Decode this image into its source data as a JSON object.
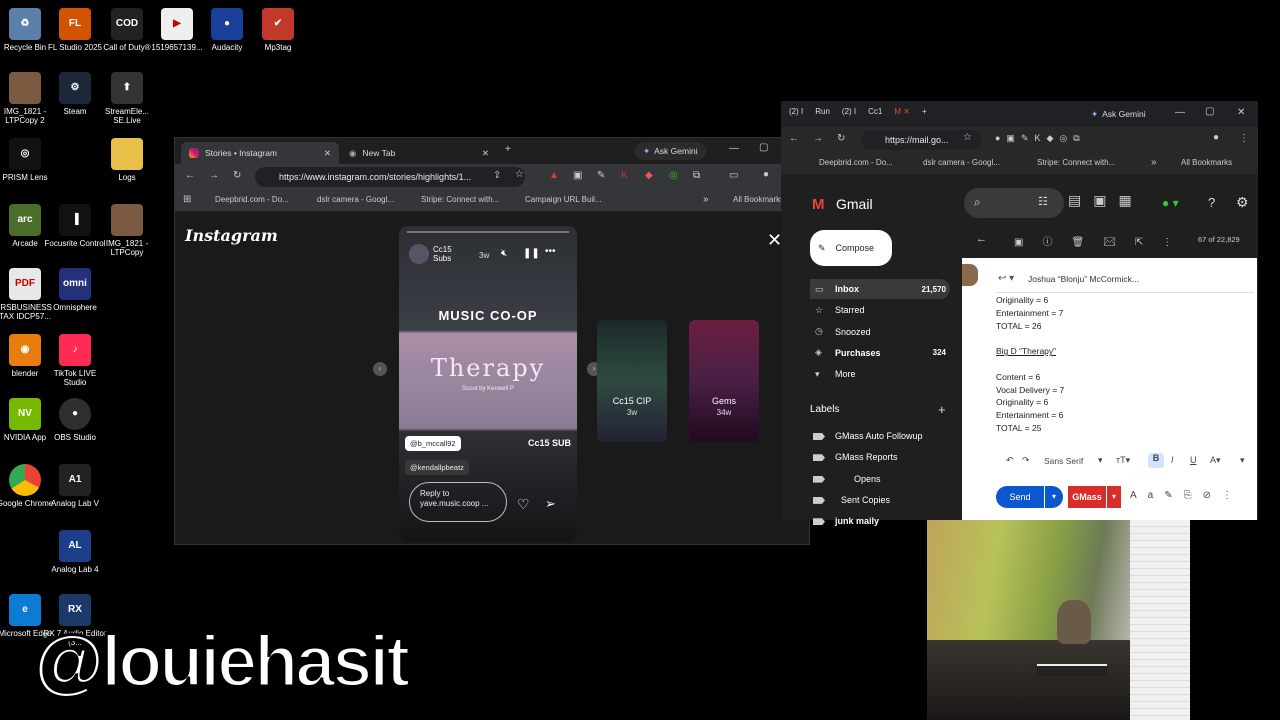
{
  "desktop": {
    "icons": [
      {
        "label": "Recycle Bin",
        "color": "#5a7fa8",
        "glyph": "♻"
      },
      {
        "label": "FL Studio 2025",
        "color": "#d35400",
        "glyph": "FL"
      },
      {
        "label": "Call of Duty®",
        "color": "#222",
        "glyph": "COD"
      },
      {
        "label": "1519657139...",
        "color": "#eee",
        "glyph": "▶"
      },
      {
        "label": "Audacity",
        "color": "#1a3f9a",
        "glyph": "●"
      },
      {
        "label": "Mp3tag",
        "color": "#c0392b",
        "glyph": "✔"
      },
      {
        "label": "IMG_1821 - LTPCopy 2",
        "color": "#7a5a40",
        "glyph": ""
      },
      {
        "label": "Steam",
        "color": "#1b2838",
        "glyph": "⚙"
      },
      {
        "label": "StreamEle... SE.Live",
        "color": "#333",
        "glyph": "⬆"
      },
      {
        "label": "PRISM Lens",
        "color": "#111",
        "glyph": "◎"
      },
      {
        "label": "Logs",
        "color": "#e8c04a",
        "glyph": ""
      },
      {
        "label": "Arcade",
        "color": "#4a6e2a",
        "glyph": "arc"
      },
      {
        "label": "Focusrite Control",
        "color": "#111",
        "glyph": "▐"
      },
      {
        "label": "IMG_1821 - LTPCopy",
        "color": "#7a5a40",
        "glyph": ""
      },
      {
        "label": "IRSBUSINESS TAX IDCP57...",
        "color": "#e8e8e8",
        "glyph": "PDF"
      },
      {
        "label": "Omnisphere",
        "color": "#23307a",
        "glyph": "omni"
      },
      {
        "label": "blender",
        "color": "#e87d0d",
        "glyph": "◉"
      },
      {
        "label": "TikTok LIVE Studio",
        "color": "#fe2c55",
        "glyph": "♪"
      },
      {
        "label": "NVIDIA App",
        "color": "#76b900",
        "glyph": "NV"
      },
      {
        "label": "OBS Studio",
        "color": "#302e31",
        "glyph": "●"
      },
      {
        "label": "Google Chrome",
        "color": "#fff",
        "glyph": ""
      },
      {
        "label": "Analog Lab V",
        "color": "#222",
        "glyph": "A1"
      },
      {
        "label": "Analog Lab 4",
        "color": "#1d3f8a",
        "glyph": "AL"
      },
      {
        "label": "Microsoft Edge",
        "color": "#0c7bd2",
        "glyph": "e"
      },
      {
        "label": "RX 7 Audio Editor (3...",
        "color": "#1a3a6a",
        "glyph": "RX"
      }
    ],
    "watermark": "@louiehasit"
  },
  "chrome_left": {
    "tabs": [
      {
        "label": "Stories • Instagram",
        "active": true
      },
      {
        "label": "New Tab",
        "active": false
      }
    ],
    "ask_gemini": "Ask Gemini",
    "url": "https://www.instagram.com/stories/highlights/1...",
    "bookmarks": [
      "Deepbrid.com - Do...",
      "dslr camera - Googl...",
      "Stripe: Connect with...",
      "Campaign URL Buil..."
    ],
    "all_bookmarks": "All Bookmarks"
  },
  "instagram": {
    "logo": "Instagram",
    "story": {
      "user": "Cc15 Subs",
      "time": "3w",
      "brand": "MUSIC CO-OP",
      "song": "Therapy",
      "song_sub": "Scout by Kenwell P",
      "mention1": "@b_mccall92",
      "mention2": "@kendallpbeatz",
      "tag_right": "Cc15 SUB",
      "reply_placeholder": "Reply to yave.music.coop ..."
    },
    "previews": [
      {
        "name": "Cc15 CIP",
        "time": "3w",
        "color": "#2f4a40"
      },
      {
        "name": "Gems",
        "time": "34w",
        "color": "#4a1f45"
      }
    ]
  },
  "chrome_right": {
    "tabs": [
      "(2) I",
      "Run",
      "(2) I",
      "Cc1"
    ],
    "ask_gemini": "Ask Gemini",
    "url": "https://mail.go...",
    "bookmarks": [
      "Deepbrid.com - Do...",
      "dslr camera - Googl...",
      "Stripe: Connect with..."
    ],
    "all_bookmarks": "All Bookmarks"
  },
  "gmail": {
    "logo": "Gmail",
    "compose": "Compose",
    "nav": [
      {
        "label": "Inbox",
        "count": "21,570",
        "bold": true
      },
      {
        "label": "Starred",
        "count": "",
        "bold": false
      },
      {
        "label": "Snoozed",
        "count": "",
        "bold": false
      },
      {
        "label": "Purchases",
        "count": "324",
        "bold": true
      },
      {
        "label": "More",
        "count": "",
        "bold": false
      }
    ],
    "labels_title": "Labels",
    "labels": [
      {
        "label": "GMass Auto Followup",
        "bold": false
      },
      {
        "label": "GMass Reports",
        "bold": false
      },
      {
        "label": "Opens",
        "bold": false
      },
      {
        "label": "Sent Copies",
        "bold": false
      },
      {
        "label": "junk maily",
        "bold": true
      }
    ],
    "page_count": "67 of 22,829",
    "from": "Joshua “Blonju” McCormick...",
    "body": [
      {
        "text": "Originality = 6",
        "bold": false
      },
      {
        "text": "Entertainment = 7",
        "bold": false
      },
      {
        "text": "TOTAL = 26",
        "bold": false
      },
      {
        "text": "",
        "bold": false
      },
      {
        "text": "Big D  “Therapy”",
        "bold": false
      },
      {
        "text": "",
        "bold": false
      },
      {
        "text": "Content = 6",
        "bold": false
      },
      {
        "text": "Vocal Delivery = 7",
        "bold": false
      },
      {
        "text": "Originality = 6",
        "bold": false
      },
      {
        "text": "Entertainment = 6",
        "bold": false
      },
      {
        "text": "TOTAL = 25",
        "bold": false
      }
    ],
    "font_name": "Sans Serif",
    "send": "Send",
    "gmass": "GMass"
  }
}
